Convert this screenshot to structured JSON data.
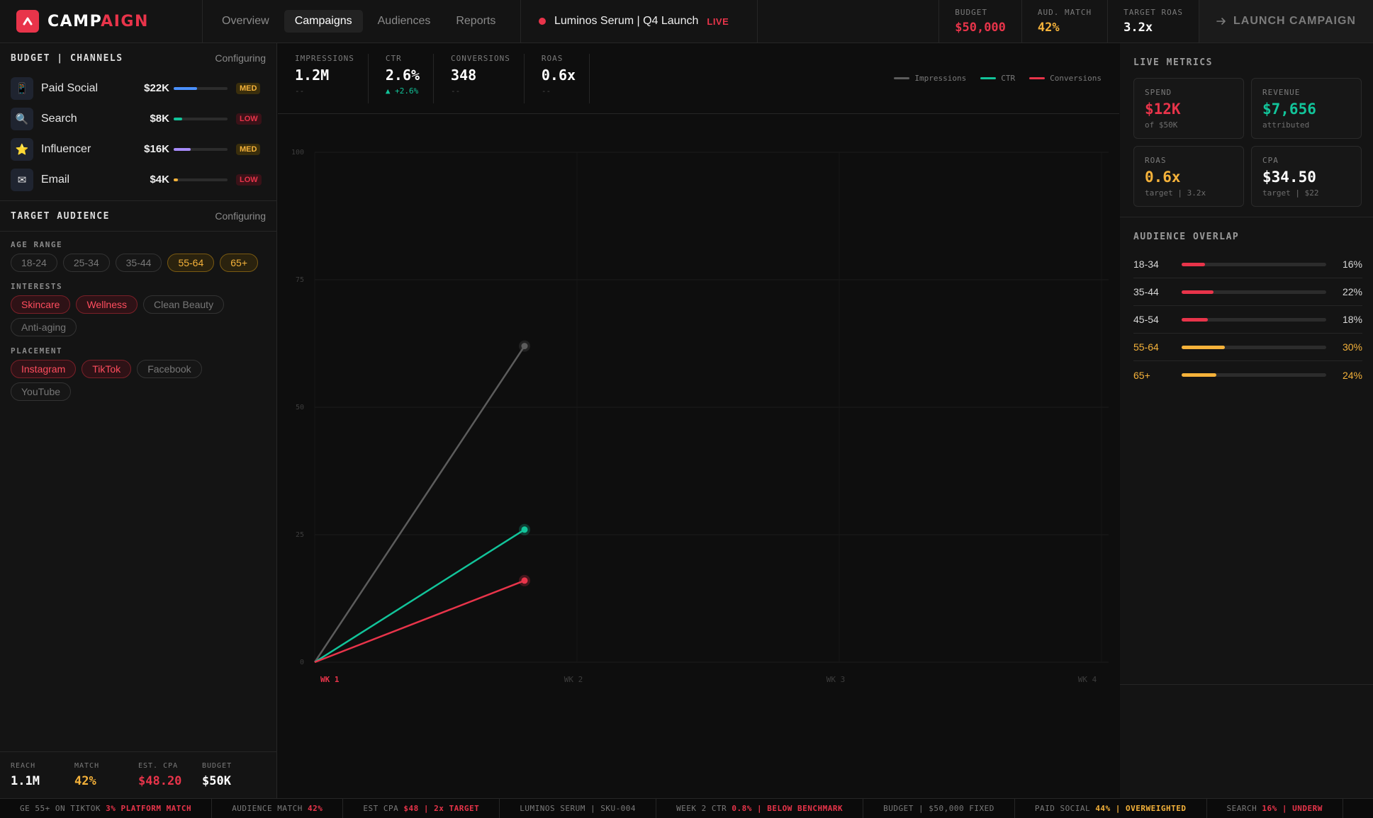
{
  "brand": {
    "name_a": "CAMP",
    "name_b": "AIGN"
  },
  "nav": {
    "tabs": [
      {
        "label": "Overview",
        "active": false
      },
      {
        "label": "Campaigns",
        "active": true
      },
      {
        "label": "Audiences",
        "active": false
      },
      {
        "label": "Reports",
        "active": false
      }
    ]
  },
  "campaign": {
    "name": "Luminos Serum | Q4 Launch",
    "status": "LIVE"
  },
  "top_stats": [
    {
      "label": "BUDGET",
      "value": "$50,000",
      "color": "#e8344a"
    },
    {
      "label": "AUD. MATCH",
      "value": "42%",
      "color": "#f5b23a"
    },
    {
      "label": "TARGET ROAS",
      "value": "3.2x",
      "color": "#ffffff"
    }
  ],
  "launch": {
    "label": "LAUNCH CAMPAIGN"
  },
  "budget_section": {
    "title": "BUDGET | CHANNELS",
    "status": "Configuring",
    "channels": [
      {
        "icon": "phone-icon",
        "glyph": "📱",
        "name": "Paid Social",
        "amount": "$22K",
        "share": 0.44,
        "color": "#4a90ff",
        "badge": "MED",
        "level": "med"
      },
      {
        "icon": "search-icon",
        "glyph": "🔍",
        "name": "Search",
        "amount": "$8K",
        "share": 0.16,
        "color": "#12c49a",
        "badge": "LOW",
        "level": "low"
      },
      {
        "icon": "star-icon",
        "glyph": "⭐",
        "name": "Influencer",
        "amount": "$16K",
        "share": 0.32,
        "color": "#a78bfa",
        "badge": "MED",
        "level": "med"
      },
      {
        "icon": "envelope-icon",
        "glyph": "✉",
        "name": "Email",
        "amount": "$4K",
        "share": 0.08,
        "color": "#f5b23a",
        "badge": "LOW",
        "level": "low"
      }
    ]
  },
  "audience_section": {
    "title": "TARGET AUDIENCE",
    "status": "Configuring",
    "age_label": "AGE RANGE",
    "ages": [
      {
        "label": "18-24",
        "state": "off"
      },
      {
        "label": "25-34",
        "state": "off"
      },
      {
        "label": "35-44",
        "state": "off"
      },
      {
        "label": "55-64",
        "state": "gold"
      },
      {
        "label": "65+",
        "state": "gold"
      }
    ],
    "interests_label": "INTERESTS",
    "interests": [
      {
        "label": "Skincare",
        "state": "red"
      },
      {
        "label": "Wellness",
        "state": "red"
      },
      {
        "label": "Clean Beauty",
        "state": "off"
      },
      {
        "label": "Anti-aging",
        "state": "off"
      }
    ],
    "placement_label": "PLACEMENT",
    "placements": [
      {
        "label": "Instagram",
        "state": "red"
      },
      {
        "label": "TikTok",
        "state": "red"
      },
      {
        "label": "Facebook",
        "state": "off"
      },
      {
        "label": "YouTube",
        "state": "off"
      }
    ]
  },
  "left_footer": [
    {
      "label": "REACH",
      "value": "1.1M",
      "color": "#ffffff"
    },
    {
      "label": "MATCH",
      "value": "42%",
      "color": "#f5b23a"
    },
    {
      "label": "EST. CPA",
      "value": "$48.20",
      "color": "#e8344a"
    },
    {
      "label": "BUDGET",
      "value": "$50K",
      "color": "#ffffff"
    }
  ],
  "kpis": [
    {
      "label": "IMPRESSIONS",
      "value": "1.2M",
      "sub": "--",
      "trend": "none"
    },
    {
      "label": "CTR",
      "value": "2.6%",
      "sub": "▲ +2.6%",
      "trend": "up"
    },
    {
      "label": "CONVERSIONS",
      "value": "348",
      "sub": "--",
      "trend": "none"
    },
    {
      "label": "ROAS",
      "value": "0.6x",
      "sub": "--",
      "trend": "none"
    }
  ],
  "chart_data": {
    "type": "line",
    "x": [
      "WK 1",
      "WK 2",
      "WK 3",
      "WK 4"
    ],
    "x_active": "WK 1",
    "ylim": [
      0,
      100
    ],
    "yticks": [
      "100",
      "75",
      "50",
      "25",
      "0"
    ],
    "grid": true,
    "legend_position": "top-right",
    "series": [
      {
        "name": "Impressions",
        "color": "#5c5c5c",
        "points": [
          [
            1,
            0
          ],
          [
            1.8,
            62
          ]
        ]
      },
      {
        "name": "CTR",
        "color": "#12c49a",
        "points": [
          [
            1,
            0
          ],
          [
            1.8,
            26
          ]
        ]
      },
      {
        "name": "Conversions",
        "color": "#e8344a",
        "points": [
          [
            1,
            0
          ],
          [
            1.8,
            16
          ]
        ]
      }
    ]
  },
  "live_metrics": {
    "title": "LIVE METRICS",
    "cards": [
      {
        "label": "SPEND",
        "value": "$12K",
        "sub": "of $50K",
        "color": "#e8344a"
      },
      {
        "label": "REVENUE",
        "value": "$7,656",
        "sub": "attributed",
        "color": "#12c49a"
      },
      {
        "label": "ROAS",
        "value": "0.6x",
        "sub": "target | 3.2x",
        "color": "#f5b23a"
      },
      {
        "label": "CPA",
        "value": "$34.50",
        "sub": "target | $22",
        "color": "#ffffff"
      }
    ]
  },
  "audience_overlap": {
    "title": "AUDIENCE OVERLAP",
    "rows": [
      {
        "label": "18-34",
        "pct": "16%",
        "value": 0.16,
        "color": "#e8344a",
        "text_color": "#d8d8d8"
      },
      {
        "label": "35-44",
        "pct": "22%",
        "value": 0.22,
        "color": "#e8344a",
        "text_color": "#d8d8d8"
      },
      {
        "label": "45-54",
        "pct": "18%",
        "value": 0.18,
        "color": "#e8344a",
        "text_color": "#d8d8d8"
      },
      {
        "label": "55-64",
        "pct": "30%",
        "value": 0.3,
        "color": "#f5b23a",
        "text_color": "#f5b23a"
      },
      {
        "label": "65+",
        "pct": "24%",
        "value": 0.24,
        "color": "#f5b23a",
        "text_color": "#f5b23a"
      }
    ]
  },
  "ticker": [
    {
      "text": "GE 55+ ON TIKTOK",
      "hl": "3% PLATFORM MATCH",
      "hl_color": "#e8344a"
    },
    {
      "text": "AUDIENCE MATCH",
      "hl": "42%",
      "hl_color": "#e8344a"
    },
    {
      "text": "EST CPA",
      "hl": "$48 | 2x TARGET",
      "hl_color": "#e8344a"
    },
    {
      "text": "LUMINOS SERUM | SKU-004",
      "hl": "",
      "hl_color": "#e8344a"
    },
    {
      "text": "WEEK 2 CTR",
      "hl": "0.8% | BELOW BENCHMARK",
      "hl_color": "#e8344a"
    },
    {
      "text": "BUDGET | $50,000 FIXED",
      "hl": "",
      "hl_color": "#e8344a"
    },
    {
      "text": "PAID SOCIAL",
      "hl": "44% | OVERWEIGHTED",
      "hl_color": "#f5b23a"
    },
    {
      "text": "SEARCH",
      "hl": "16% | UNDERW",
      "hl_color": "#e8344a"
    }
  ]
}
